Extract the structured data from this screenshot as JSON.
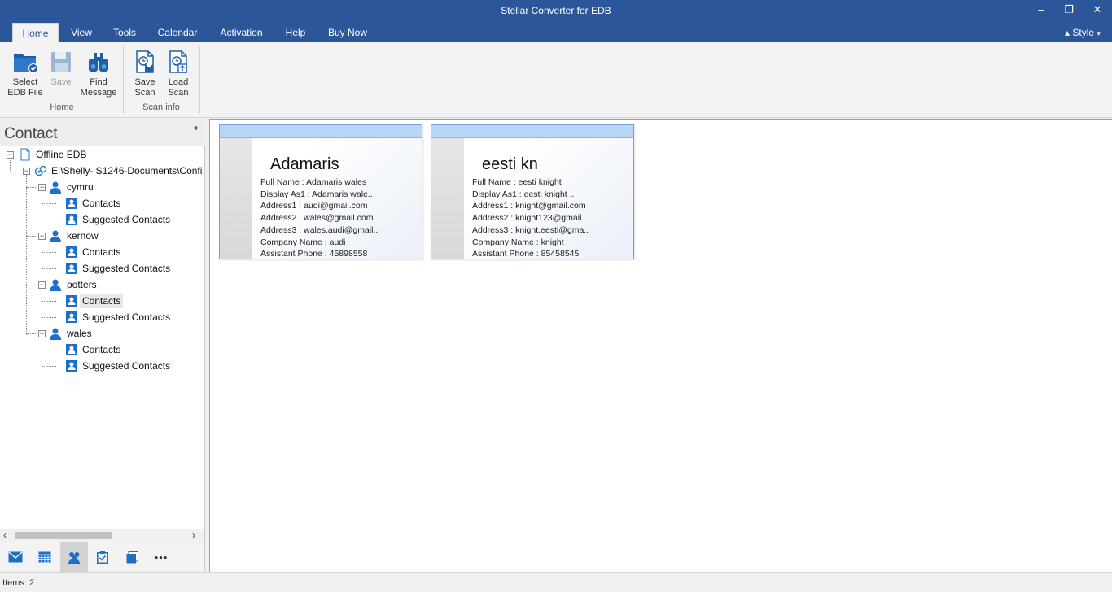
{
  "window": {
    "title": "Stellar Converter for EDB",
    "minimize": "–",
    "maximize": "❐",
    "close": "✕"
  },
  "menu": {
    "tabs": [
      "Home",
      "View",
      "Tools",
      "Calendar",
      "Activation",
      "Help",
      "Buy Now"
    ],
    "active": "Home",
    "style_label": "Style"
  },
  "ribbon": {
    "home_group": {
      "label": "Home",
      "buttons": [
        {
          "line1": "Select",
          "line2": "EDB File",
          "icon": "folder-icon",
          "enabled": true
        },
        {
          "line1": "Save",
          "line2": "",
          "icon": "save-icon",
          "enabled": false
        },
        {
          "line1": "Find",
          "line2": "Message",
          "icon": "binoculars-icon",
          "enabled": true
        }
      ]
    },
    "scan_group": {
      "label": "Scan info",
      "buttons": [
        {
          "line1": "Save",
          "line2": "Scan",
          "icon": "save-scan-icon",
          "enabled": true
        },
        {
          "line1": "Load",
          "line2": "Scan",
          "icon": "load-scan-icon",
          "enabled": true
        }
      ]
    }
  },
  "left_pane": {
    "title": "Contact",
    "tree": {
      "root": "Offline EDB",
      "path": "E:\\Shelly- S1246-Documents\\Confi",
      "mailboxes": [
        {
          "name": "cymru",
          "folders": [
            "Contacts",
            "Suggested Contacts"
          ]
        },
        {
          "name": "kernow",
          "folders": [
            "Contacts",
            "Suggested Contacts"
          ]
        },
        {
          "name": "potters",
          "folders": [
            "Contacts",
            "Suggested Contacts"
          ]
        },
        {
          "name": "wales",
          "folders": [
            "Contacts",
            "Suggested Contacts"
          ]
        }
      ],
      "selected": "potters/Contacts"
    },
    "nav_buttons": [
      "mail-icon",
      "calendar-icon",
      "contacts-icon",
      "tasks-icon",
      "notes-icon",
      "more-icon"
    ],
    "nav_active": "contacts-icon",
    "more_label": "•••"
  },
  "cards": [
    {
      "name": "Adamaris",
      "fields": [
        "Full Name : Adamaris wales",
        "Display As1 : Adamaris wale..",
        "Address1 : audi@gmail.com",
        "Address2 : wales@gmail.com",
        "Address3 : wales.audi@gmail..",
        "Company Name : audi",
        "Assistant Phone : 45898558"
      ]
    },
    {
      "name": "eesti kn",
      "fields": [
        "Full Name : eesti knight",
        "Display As1 : eesti knight ..",
        "Address1 : knight@gmail.com",
        "Address2 : knight123@gmail...",
        "Address3 : knight.eesti@gma..",
        "Company Name : knight",
        "Assistant Phone : 85458545"
      ]
    }
  ],
  "status": {
    "items": "Items: 2"
  },
  "colors": {
    "accent": "#2b579a",
    "icon_blue": "#1e6fc7",
    "card_header": "#b8d6f8"
  }
}
